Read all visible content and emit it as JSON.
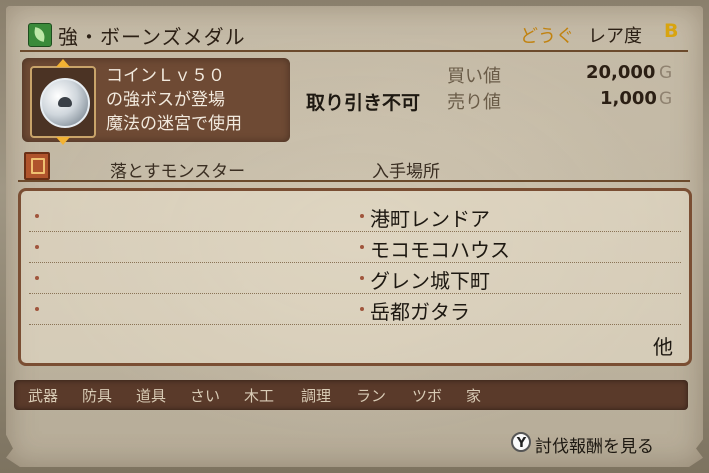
{
  "header": {
    "item_name": "強・ボーンズメダル",
    "category": "どうぐ",
    "rarity_label": "レア度",
    "rarity_value": "B",
    "item_icon": "leaf-icon"
  },
  "item": {
    "icon": "skull-medal-icon",
    "description_lines": [
      "コインＬｖ５０",
      "の強ボスが登場",
      "魔法の迷宮で使用"
    ]
  },
  "trade": {
    "status": "取り引き不可",
    "buy_label": "買い値",
    "buy_value": "20,000",
    "sell_label": "売り値",
    "sell_value": "1,000",
    "currency": "G"
  },
  "columns": {
    "monster_header": "落とすモンスター",
    "location_header": "入手場所",
    "book_icon": "book-icon"
  },
  "locations": [
    "港町レンドア",
    "モコモコハウス",
    "グレン城下町",
    "岳都ガタラ"
  ],
  "more_label": "他",
  "tabs": [
    "武器",
    "防具",
    "道具",
    "さい",
    "木工",
    "調理",
    "ラン",
    "ツボ",
    "家"
  ],
  "footer": {
    "button": "Y",
    "label": "討伐報酬を見る"
  },
  "colors": {
    "category": "#c1820f",
    "rarity": "#d8a410",
    "panel_border": "#7a4e33"
  }
}
